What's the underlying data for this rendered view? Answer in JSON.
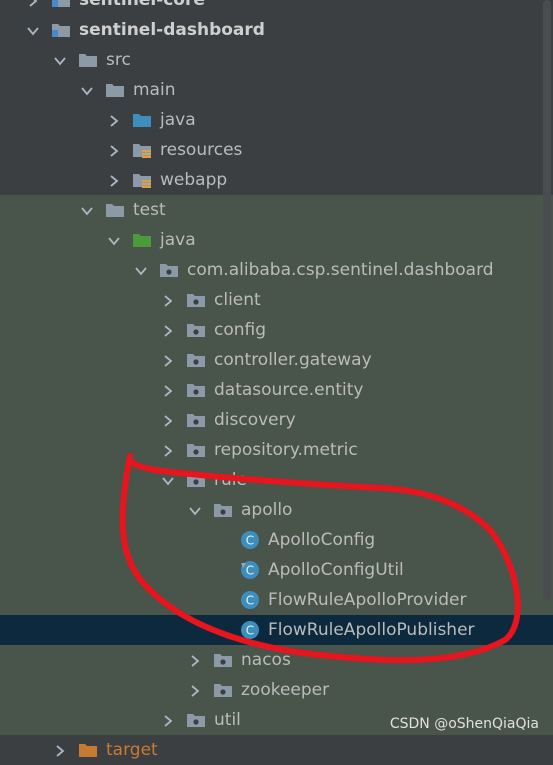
{
  "tree": {
    "items": [
      {
        "label": "sentinel-core",
        "level": 0,
        "expanded": false,
        "icon": "module-folder",
        "bold": true
      },
      {
        "label": "sentinel-dashboard",
        "level": 0,
        "expanded": true,
        "icon": "module-folder",
        "bold": true
      },
      {
        "label": "src",
        "level": 1,
        "expanded": true,
        "icon": "folder"
      },
      {
        "label": "main",
        "level": 2,
        "expanded": true,
        "icon": "folder"
      },
      {
        "label": "java",
        "level": 3,
        "expanded": false,
        "icon": "source-folder"
      },
      {
        "label": "resources",
        "level": 3,
        "expanded": false,
        "icon": "resources-folder"
      },
      {
        "label": "webapp",
        "level": 3,
        "expanded": false,
        "icon": "resources-folder"
      },
      {
        "label": "test",
        "level": 2,
        "expanded": true,
        "icon": "folder"
      },
      {
        "label": "java",
        "level": 3,
        "expanded": true,
        "icon": "test-source-folder"
      },
      {
        "label": "com.alibaba.csp.sentinel.dashboard",
        "level": 4,
        "expanded": true,
        "icon": "package"
      },
      {
        "label": "client",
        "level": 5,
        "expanded": false,
        "icon": "package"
      },
      {
        "label": "config",
        "level": 5,
        "expanded": false,
        "icon": "package"
      },
      {
        "label": "controller.gateway",
        "level": 5,
        "expanded": false,
        "icon": "package"
      },
      {
        "label": "datasource.entity",
        "level": 5,
        "expanded": false,
        "icon": "package"
      },
      {
        "label": "discovery",
        "level": 5,
        "expanded": false,
        "icon": "package"
      },
      {
        "label": "repository.metric",
        "level": 5,
        "expanded": false,
        "icon": "package"
      },
      {
        "label": "rule",
        "level": 5,
        "expanded": true,
        "icon": "package"
      },
      {
        "label": "apollo",
        "level": 6,
        "expanded": true,
        "icon": "package"
      },
      {
        "label": "ApolloConfig",
        "level": 7,
        "icon": "class"
      },
      {
        "label": "ApolloConfigUtil",
        "level": 7,
        "icon": "class-util"
      },
      {
        "label": "FlowRuleApolloProvider",
        "level": 7,
        "icon": "class"
      },
      {
        "label": "FlowRuleApolloPublisher",
        "level": 7,
        "icon": "class",
        "selected": true
      },
      {
        "label": "nacos",
        "level": 6,
        "expanded": false,
        "icon": "package"
      },
      {
        "label": "zookeeper",
        "level": 6,
        "expanded": false,
        "icon": "package"
      },
      {
        "label": "util",
        "level": 5,
        "expanded": false,
        "icon": "package"
      },
      {
        "label": "target",
        "level": 1,
        "expanded": false,
        "icon": "excluded-folder"
      }
    ]
  },
  "colors": {
    "background": "#3c3f41",
    "test_background": "#49544a",
    "selected": "#0d293e",
    "annotation": "#e8141e"
  },
  "watermark": "CSDN @oShenQiaQia"
}
